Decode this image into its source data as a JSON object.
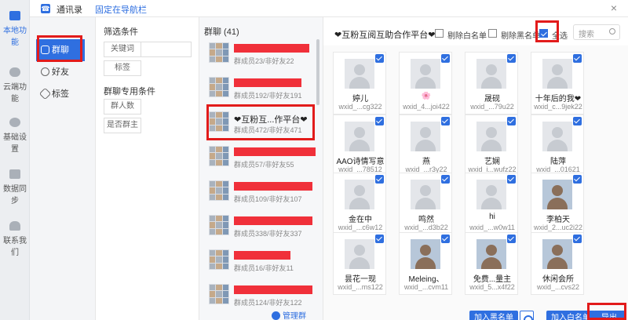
{
  "rail": [
    {
      "label": "本地功能",
      "icon": "monitor-icon",
      "active": true
    },
    {
      "label": "云端功能",
      "icon": "cloud-icon"
    },
    {
      "label": "基础设置",
      "icon": "gear-icon"
    },
    {
      "label": "数据同步",
      "icon": "sync-icon"
    },
    {
      "label": "联系我们",
      "icon": "person-icon"
    }
  ],
  "topbar": {
    "title": "通讯录",
    "pin": "固定在导航栏",
    "close": "×"
  },
  "nav": [
    {
      "label": "群聊",
      "icon": "group-icon",
      "active": true
    },
    {
      "label": "好友",
      "icon": "friend-icon"
    },
    {
      "label": "标签",
      "icon": "tag-icon"
    }
  ],
  "filters": {
    "title": "筛选条件",
    "keyword_btn": "关键词",
    "tag_btn": "标签",
    "group_title": "群聊专用条件",
    "count_btn": "群人数",
    "owner_btn": "是否群主"
  },
  "grouplist": {
    "header": "群聊 (41)",
    "groups": [
      {
        "name": "",
        "sub": "群成员23/非好友22"
      },
      {
        "name": "",
        "sub": "群成员192/非好友191"
      },
      {
        "name": "❤互粉互...作平台❤",
        "sub": "群成员472/非好友471"
      },
      {
        "name": "",
        "sub": "群成员57/非好友55"
      },
      {
        "name": "",
        "sub": "群成员109/非好友107"
      },
      {
        "name": "",
        "sub": "群成员338/非好友337"
      },
      {
        "name": "",
        "sub": "群成员16/非好友11"
      },
      {
        "name": "",
        "sub": "群成员124/非好友122"
      }
    ],
    "manage": "管理群"
  },
  "members": {
    "title": "❤互粉互阅互助合作平台❤",
    "remove_whitelist": "剔除白名单",
    "remove_blacklist": "剔除黑名单",
    "select_all": "全选",
    "search_placeholder": "搜索",
    "cards": [
      {
        "name": "婷儿",
        "id": "wxid_...cg322",
        "photo": false
      },
      {
        "name": "🌸",
        "id": "wxid_4...joi422",
        "photo": false
      },
      {
        "name": "晟砚",
        "id": "wxid_...79u22",
        "photo": false
      },
      {
        "name": "十年后的我❤",
        "id": "wxid_c...9jek22",
        "photo": false
      },
      {
        "name": "AAO诗情写意",
        "id": "wxid_...78512",
        "photo": false
      },
      {
        "name": "燕",
        "id": "wxid_...r3y22",
        "photo": false
      },
      {
        "name": "艺娴",
        "id": "wxid_i...wufz22",
        "photo": false
      },
      {
        "name": "陆萍",
        "id": "wxid_...01621",
        "photo": false
      },
      {
        "name": "金在中",
        "id": "wxid_...c6w12",
        "photo": false
      },
      {
        "name": "鸣然",
        "id": "wxid_...d3b22",
        "photo": false
      },
      {
        "name": "hi",
        "id": "wxid_...w0w11",
        "photo": false
      },
      {
        "name": "李柏天",
        "id": "wxid_2...uc2i22",
        "photo": true
      },
      {
        "name": "昙花一现",
        "id": "wxid_...ms122",
        "photo": false
      },
      {
        "name": "Meleing、",
        "id": "wxid_...cvm11",
        "photo": true
      },
      {
        "name": "免费...量主",
        "id": "wxid_5...x4f22",
        "photo": true
      },
      {
        "name": "休闲会所",
        "id": "wxid_...cvs22",
        "photo": true
      }
    ],
    "add_blacklist": "加入黑名单",
    "add_whitelist": "加入白名单",
    "export": "导出"
  }
}
